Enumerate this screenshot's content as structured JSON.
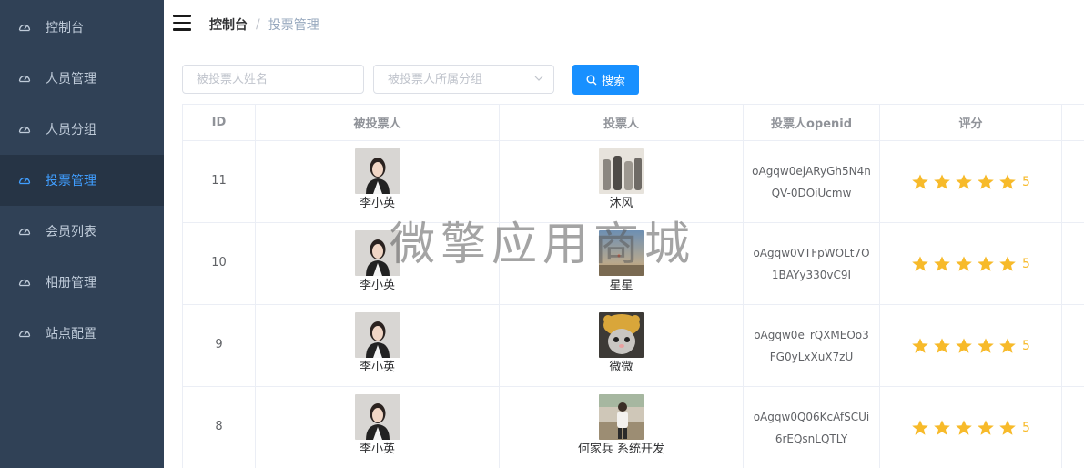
{
  "sidebar": {
    "items": [
      {
        "label": "控制台",
        "icon": "dashboard-icon"
      },
      {
        "label": "人员管理",
        "icon": "dashboard-icon"
      },
      {
        "label": "人员分组",
        "icon": "dashboard-icon"
      },
      {
        "label": "投票管理",
        "icon": "dashboard-icon",
        "active": true
      },
      {
        "label": "会员列表",
        "icon": "dashboard-icon"
      },
      {
        "label": "相册管理",
        "icon": "dashboard-icon"
      },
      {
        "label": "站点配置",
        "icon": "dashboard-icon"
      }
    ]
  },
  "header": {
    "breadcrumb": {
      "home": "控制台",
      "separator": "/",
      "current": "投票管理"
    }
  },
  "filters": {
    "name_placeholder": "被投票人姓名",
    "group_placeholder": "被投票人所属分组",
    "search_label": "搜索"
  },
  "table": {
    "columns": [
      "ID",
      "被投票人",
      "投票人",
      "投票人openid",
      "评分"
    ],
    "rows": [
      {
        "id": "11",
        "target": "李小英",
        "voter": "沐风",
        "openid": "oAgqw0ejARyGh5N4nQV-0DOiUcmw",
        "rating": 5,
        "score": "5"
      },
      {
        "id": "10",
        "target": "李小英",
        "voter": "星星",
        "openid": "oAgqw0VTFpWOLt7O1BAYy330vC9I",
        "rating": 5,
        "score": "5"
      },
      {
        "id": "9",
        "target": "李小英",
        "voter": "微微",
        "openid": "oAgqw0e_rQXMEOo3FG0yLxXuX7zU",
        "rating": 5,
        "score": "5"
      },
      {
        "id": "8",
        "target": "李小英",
        "voter": "何家兵 系统开发",
        "openid": "oAgqw0Q06KcAfSCUi6rEQsnLQTLY",
        "rating": 5,
        "score": "5"
      }
    ]
  },
  "watermark": "微擎应用商城",
  "colors": {
    "sidebar_bg": "#304156",
    "sidebar_active_bg": "#263445",
    "accent": "#409eff",
    "button": "#1890ff",
    "star": "#f7ba2a"
  }
}
